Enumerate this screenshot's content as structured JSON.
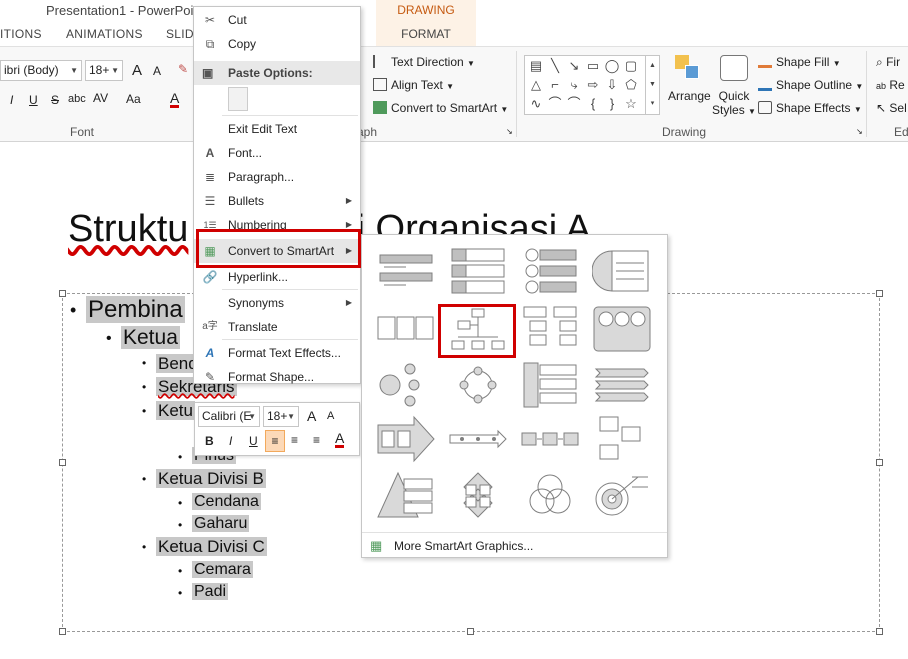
{
  "window": {
    "title": "Presentation1 - PowerPoint"
  },
  "contextual_tab": {
    "group_label": "DRAWING TOOLS",
    "tab_label": "FORMAT"
  },
  "tabs": [
    {
      "label": "ITIONS"
    },
    {
      "label": "ANIMATIONS"
    },
    {
      "label": "SLIDE"
    }
  ],
  "ribbon": {
    "font": {
      "font_name": "ibri (Body)",
      "font_size": "18+",
      "group_label": "Font",
      "grow_label": "A",
      "shrink_label": "A",
      "bold": "I",
      "underline": "U",
      "strike": "S",
      "shadow": "abc",
      "spacing": "AV",
      "case": "Aa",
      "color": "A"
    },
    "paragraph": {
      "group_label": "aph",
      "text_direction": "Text Direction",
      "align_text": "Align Text",
      "convert_smartart": "Convert to SmartArt"
    },
    "drawing": {
      "group_label": "Drawing",
      "arrange": "Arrange",
      "quick_styles_1": "Quick",
      "quick_styles_2": "Styles",
      "shape_fill": "Shape Fill",
      "shape_outline": "Shape Outline",
      "shape_effects": "Shape Effects"
    },
    "editing": {
      "group_label": "Ed",
      "find": "Fir",
      "replace": "Re",
      "select": "Sel"
    }
  },
  "context_menu": {
    "items": [
      {
        "label": "Cut",
        "icon": "scissors-icon"
      },
      {
        "label": "Copy",
        "icon": "copy-icon"
      },
      {
        "label": "Paste Options:",
        "icon": "paste-icon"
      },
      {
        "label": "Exit Edit Text",
        "icon": ""
      },
      {
        "label": "Font...",
        "icon": "font-icon"
      },
      {
        "label": "Paragraph...",
        "icon": "paragraph-icon"
      },
      {
        "label": "Bullets",
        "icon": "bullets-icon"
      },
      {
        "label": "Numbering",
        "icon": "numbering-icon"
      },
      {
        "label": "Convert to SmartArt",
        "icon": "smartart-icon"
      },
      {
        "label": "Hyperlink...",
        "icon": "hyperlink-icon"
      },
      {
        "label": "Synonyms",
        "icon": ""
      },
      {
        "label": "Translate",
        "icon": "translate-icon"
      },
      {
        "label": "Format Text Effects...",
        "icon": "text-effects-icon"
      },
      {
        "label": "Format Shape...",
        "icon": "format-shape-icon"
      }
    ]
  },
  "smartart_gallery": {
    "more_label": "More SmartArt Graphics..."
  },
  "mini_toolbar": {
    "font_name": "Calibri (E",
    "font_size": "18+",
    "grow": "A",
    "shrink": "A",
    "bold": "B",
    "italic": "I",
    "underline": "U",
    "color": "A"
  },
  "slide": {
    "title_visible": "Struktu",
    "title_tail": "asi Organisasi A",
    "bullets": [
      {
        "level": 1,
        "text": "Pembina"
      },
      {
        "level": 2,
        "text": "Ketua"
      },
      {
        "level": 3,
        "text": "Bend"
      },
      {
        "level": 3,
        "text": "Sekretaris"
      },
      {
        "level": 3,
        "text": "Ketu"
      },
      {
        "level": 4,
        "text": "Pinus"
      },
      {
        "level": 3,
        "text": "Ketua Divisi B"
      },
      {
        "level": 4,
        "text": "Cendana"
      },
      {
        "level": 4,
        "text": "Gaharu"
      },
      {
        "level": 3,
        "text": "Ketua Divisi C"
      },
      {
        "level": 4,
        "text": "Cemara"
      },
      {
        "level": 4,
        "text": "Padi"
      }
    ]
  },
  "colors": {
    "accent_red": "#d00000",
    "contextual_orange": "#c55a11"
  }
}
